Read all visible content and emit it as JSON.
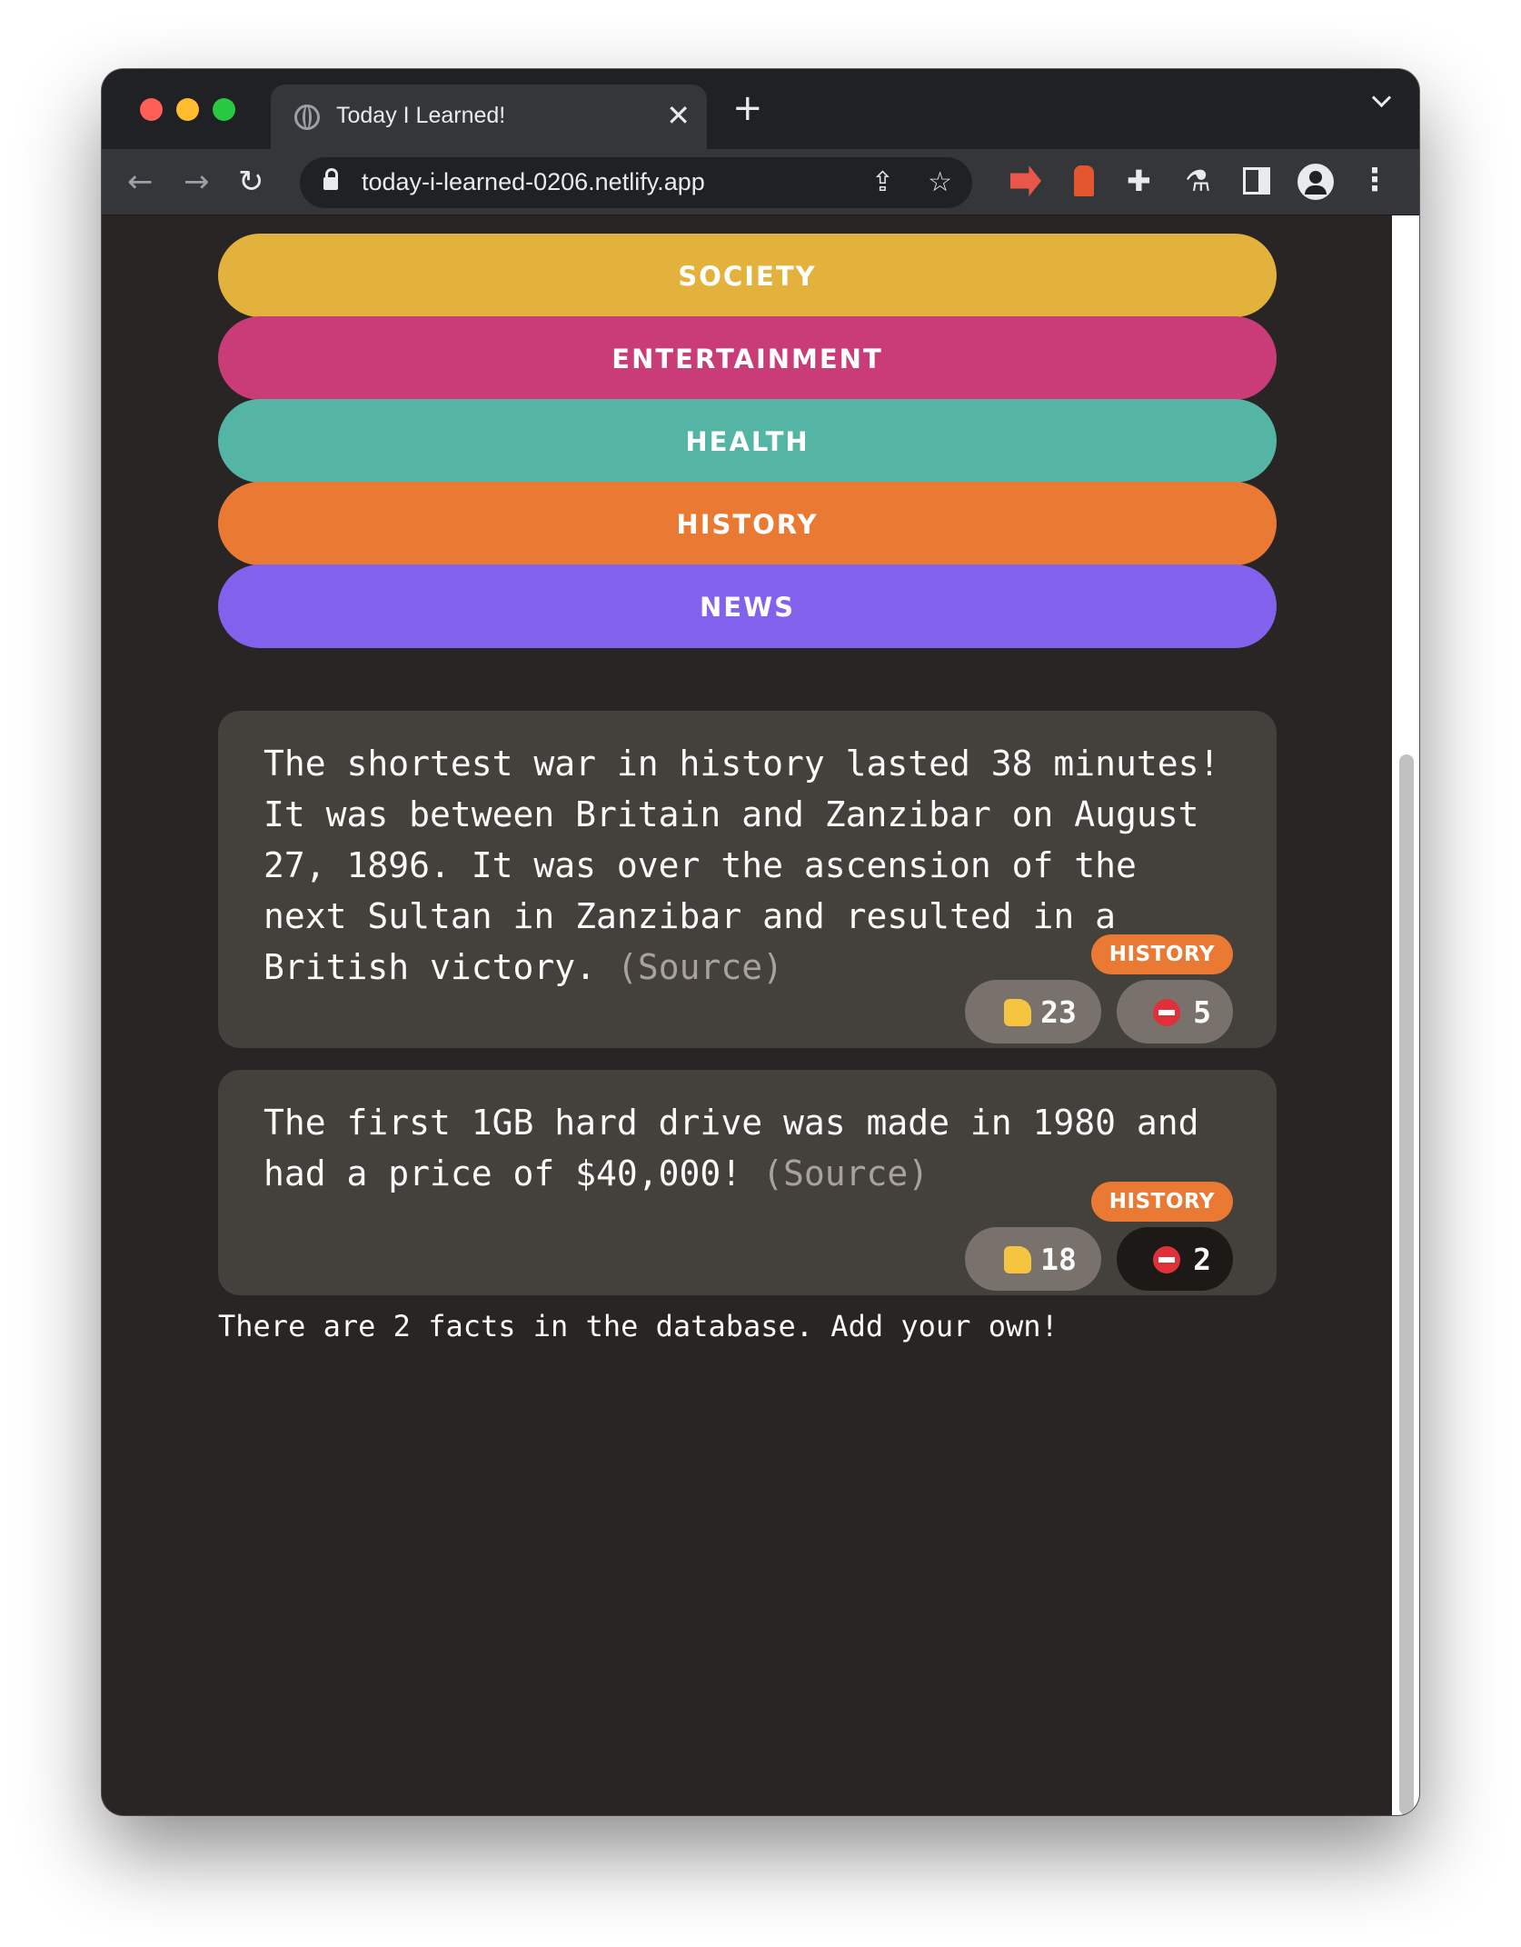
{
  "browser": {
    "tab_title": "Today I Learned!",
    "tab_close": "✕",
    "new_tab": "+",
    "url": "today-i-learned-0206.netlify.app",
    "back": "←",
    "forward": "→",
    "reload": "↻",
    "share": "⇪",
    "star": "☆",
    "puzzle": "✚",
    "flask": "⚗",
    "kebab": "⋮"
  },
  "categories": [
    {
      "label": "SOCIETY",
      "color": "#e3b23c"
    },
    {
      "label": "ENTERTAINMENT",
      "color": "#c93c78"
    },
    {
      "label": "HEALTH",
      "color": "#54b5a4"
    },
    {
      "label": "HISTORY",
      "color": "#ea7a33"
    },
    {
      "label": "NEWS",
      "color": "#8262ec"
    }
  ],
  "facts": [
    {
      "text": "The shortest war in history lasted 38 minutes! It was between Britain and Zanzibar on August 27, 1896. It was over the ascension of the next Sultan in Zanzibar and resulted in a British victory.",
      "source": "(Source)",
      "category": "HISTORY",
      "votes_interesting": "23",
      "votes_false": "5"
    },
    {
      "text": "The first 1GB hard drive was made in 1980 and had a price of $40,000!",
      "source": "(Source)",
      "category": "HISTORY",
      "votes_interesting": "18",
      "votes_false": "2"
    }
  ],
  "footer": "There are 2 facts in the database. Add your own!"
}
